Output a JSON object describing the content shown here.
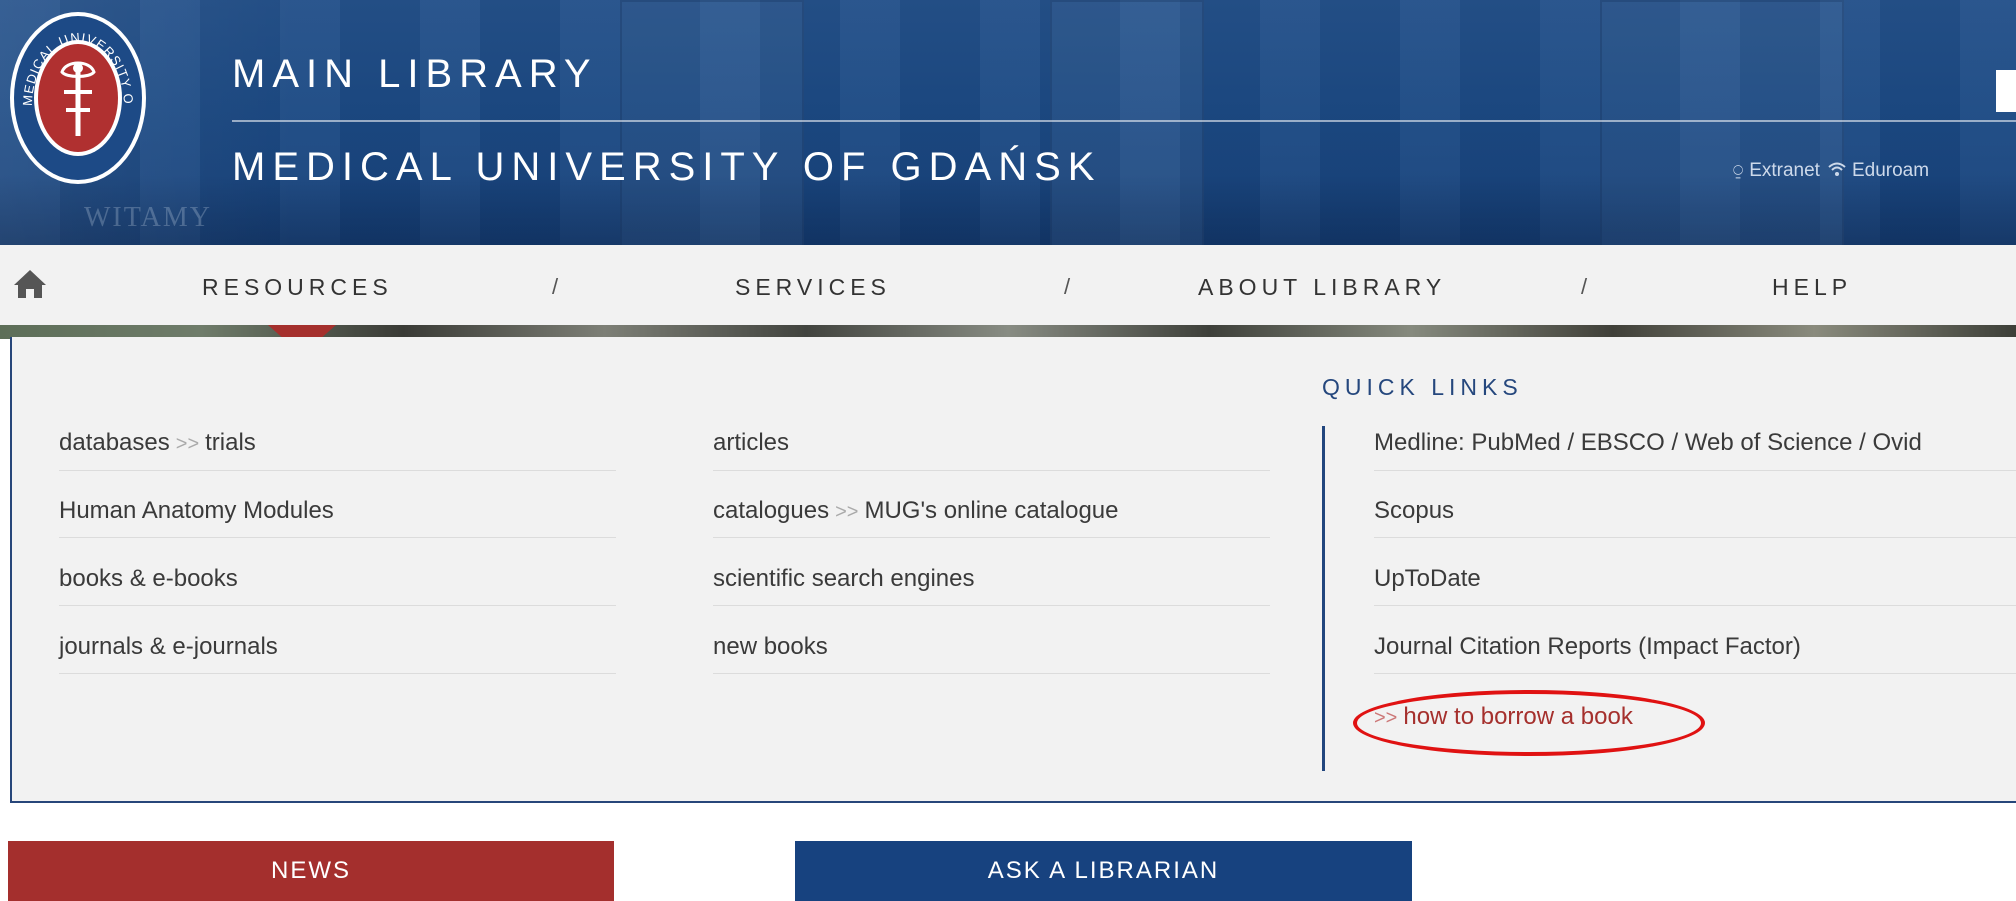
{
  "header": {
    "title_line1": "MAIN LIBRARY",
    "title_line2": "MEDICAL UNIVERSITY OF GDAŃSK",
    "seal_text": "MEDICAL UNIVERSITY OF GDAŃSK",
    "background_sign": "WITAMY",
    "links": [
      {
        "label": "Extranet",
        "icon": "graduation-cap-icon"
      },
      {
        "label": "Eduroam",
        "icon": "wifi-icon"
      }
    ]
  },
  "nav": {
    "home_icon": "home-icon",
    "items": [
      "RESOURCES",
      "SERVICES",
      "ABOUT LIBRARY",
      "HELP"
    ],
    "separator": "/"
  },
  "dropdown": {
    "col1": [
      {
        "main": "databases",
        "sep": ">>",
        "sub": "trials"
      },
      {
        "main": "Human Anatomy Modules"
      },
      {
        "main": "books & e-books"
      },
      {
        "main": "journals & e-journals"
      }
    ],
    "col2": [
      {
        "main": "articles"
      },
      {
        "main": "catalogues",
        "sep": ">>",
        "sub": "MUG's online catalogue"
      },
      {
        "main": "scientific search engines"
      },
      {
        "main": "new books"
      }
    ],
    "quick_links": {
      "title": "QUICK LINKS",
      "items": [
        "Medline: PubMed / EBSCO / Web of Science / Ovid",
        "Scopus",
        "UpToDate",
        "Journal Citation Reports (Impact Factor)"
      ],
      "highlight": {
        "sep": ">>",
        "label": "how to borrow a book"
      }
    }
  },
  "buttons": {
    "news": "NEWS",
    "ask": "ASK A LIBRARIAN"
  },
  "colors": {
    "header_blue": "#1c4a84",
    "accent_red": "#a42f2d",
    "button_blue": "#17427f",
    "annotation_red": "#e01212"
  }
}
